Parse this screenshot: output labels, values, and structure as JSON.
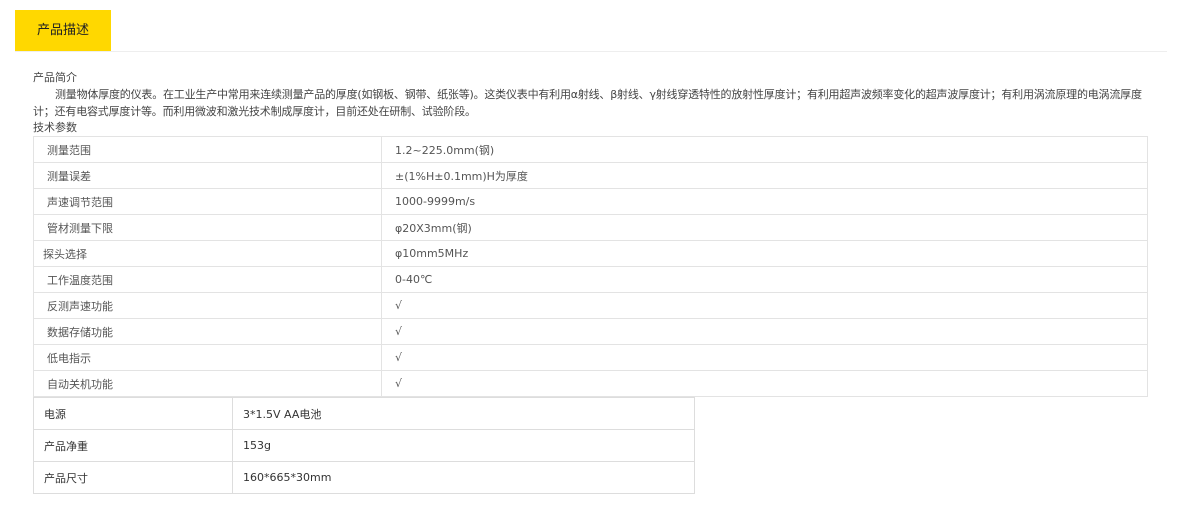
{
  "tab": {
    "label": "产品描述"
  },
  "intro": {
    "heading": "产品简介",
    "text": "测量物体厚度的仪表。在工业生产中常用来连续测量产品的厚度(如钢板、钢带、纸张等)。这类仪表中有利用α射线、β射线、γ射线穿透特性的放射性厚度计；有利用超声波频率变化的超声波厚度计；有利用涡流原理的电涡流厚度计；还有电容式厚度计等。而利用微波和激光技术制成厚度计，目前还处在研制、试验阶段。"
  },
  "specs": {
    "heading": "技术参数",
    "rows": [
      {
        "key": "测量范围",
        "value": "1.2~225.0mm(钢)"
      },
      {
        "key": "测量误差",
        "value": "±(1%H±0.1mm)H为厚度"
      },
      {
        "key": "声速调节范围",
        "value": "1000-9999m/s"
      },
      {
        "key": "管材测量下限",
        "value": "φ20X3mm(钢)"
      },
      {
        "key": "探头选择",
        "value": "φ10mm5MHz"
      },
      {
        "key": "工作温度范围",
        "value": "0-40℃"
      },
      {
        "key": "反测声速功能",
        "value": "√"
      },
      {
        "key": "数据存储功能",
        "value": "√"
      },
      {
        "key": "低电指示",
        "value": "√"
      },
      {
        "key": "自动关机功能",
        "value": "√"
      }
    ]
  },
  "power": {
    "rows": [
      {
        "key": "电源",
        "value": "3*1.5V AA电池"
      },
      {
        "key": "产品净重",
        "value": "153g"
      },
      {
        "key": "产品尺寸",
        "value": "160*665*30mm"
      }
    ]
  },
  "colors": {
    "tab_background": "#ffd800",
    "border": "#e3e3e3"
  }
}
